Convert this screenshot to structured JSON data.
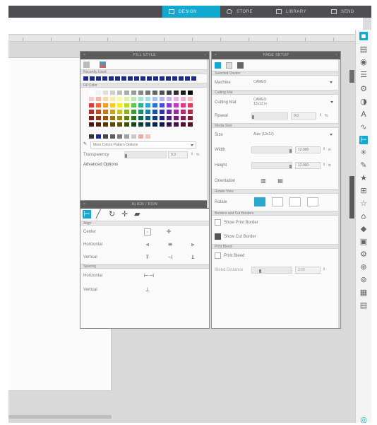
{
  "topnav": {
    "items": [
      {
        "label": "DESIGN",
        "active": true
      },
      {
        "label": "STORE",
        "active": false
      },
      {
        "label": "LIBRARY",
        "active": false
      },
      {
        "label": "SEND",
        "active": false
      }
    ]
  },
  "fill_panel": {
    "title": "FILL STYLE",
    "recently_used_label": "Recently Used",
    "fill_color_label": "Fill Color",
    "advanced_link": "More Colors Pattern Options",
    "transparency_label": "Transparency",
    "transparency_value": "0.0",
    "transparency_unit": "%",
    "advanced_options_label": "Advanced Options"
  },
  "align_panel": {
    "title": "ALIGN / ROW",
    "align_section": "Align",
    "center_label": "Center",
    "horizontal_label": "Horizontal",
    "vertical_label": "Vertical",
    "spacing_section": "Spacing",
    "sp_horizontal_label": "Horizontal",
    "sp_vertical_label": "Vertical"
  },
  "page_panel": {
    "title": "PAGE SETUP",
    "selected_device_section": "Selected Device",
    "machine_label": "Machine",
    "machine_value": "CAMEO",
    "cutting_mat_section": "Cutting Mat",
    "cutting_mat_label": "Cutting Mat",
    "cutting_mat_value_line1": "CAMEO",
    "cutting_mat_value_line2": "12x12 in",
    "reveal_label": "Reveal",
    "reveal_value": "0.0",
    "reveal_unit": "%",
    "media_size_section": "Media Size",
    "size_label": "Size",
    "size_value": "Auto (12x12)",
    "width_label": "Width",
    "width_value": "12.000",
    "width_unit": "in",
    "height_label": "Height",
    "height_value": "12.000",
    "height_unit": "in",
    "orientation_label": "Orientation",
    "rotate_section": "Rotate View",
    "rotate_label": "Rotate",
    "borders_section": "Borders and Cut Borders",
    "show_print_border": "Show Print Border",
    "show_cut_border": "Show Cut Border",
    "print_bleed_section": "Print Bleed",
    "print_bleed_label": "Print Bleed",
    "bleed_distance_label": "Bleed Distance",
    "bleed_value": "0.00"
  },
  "colors": {
    "accent": "#12a8cf",
    "title_bar": "#5c5c5c",
    "top_bar": "#4d4f53"
  }
}
